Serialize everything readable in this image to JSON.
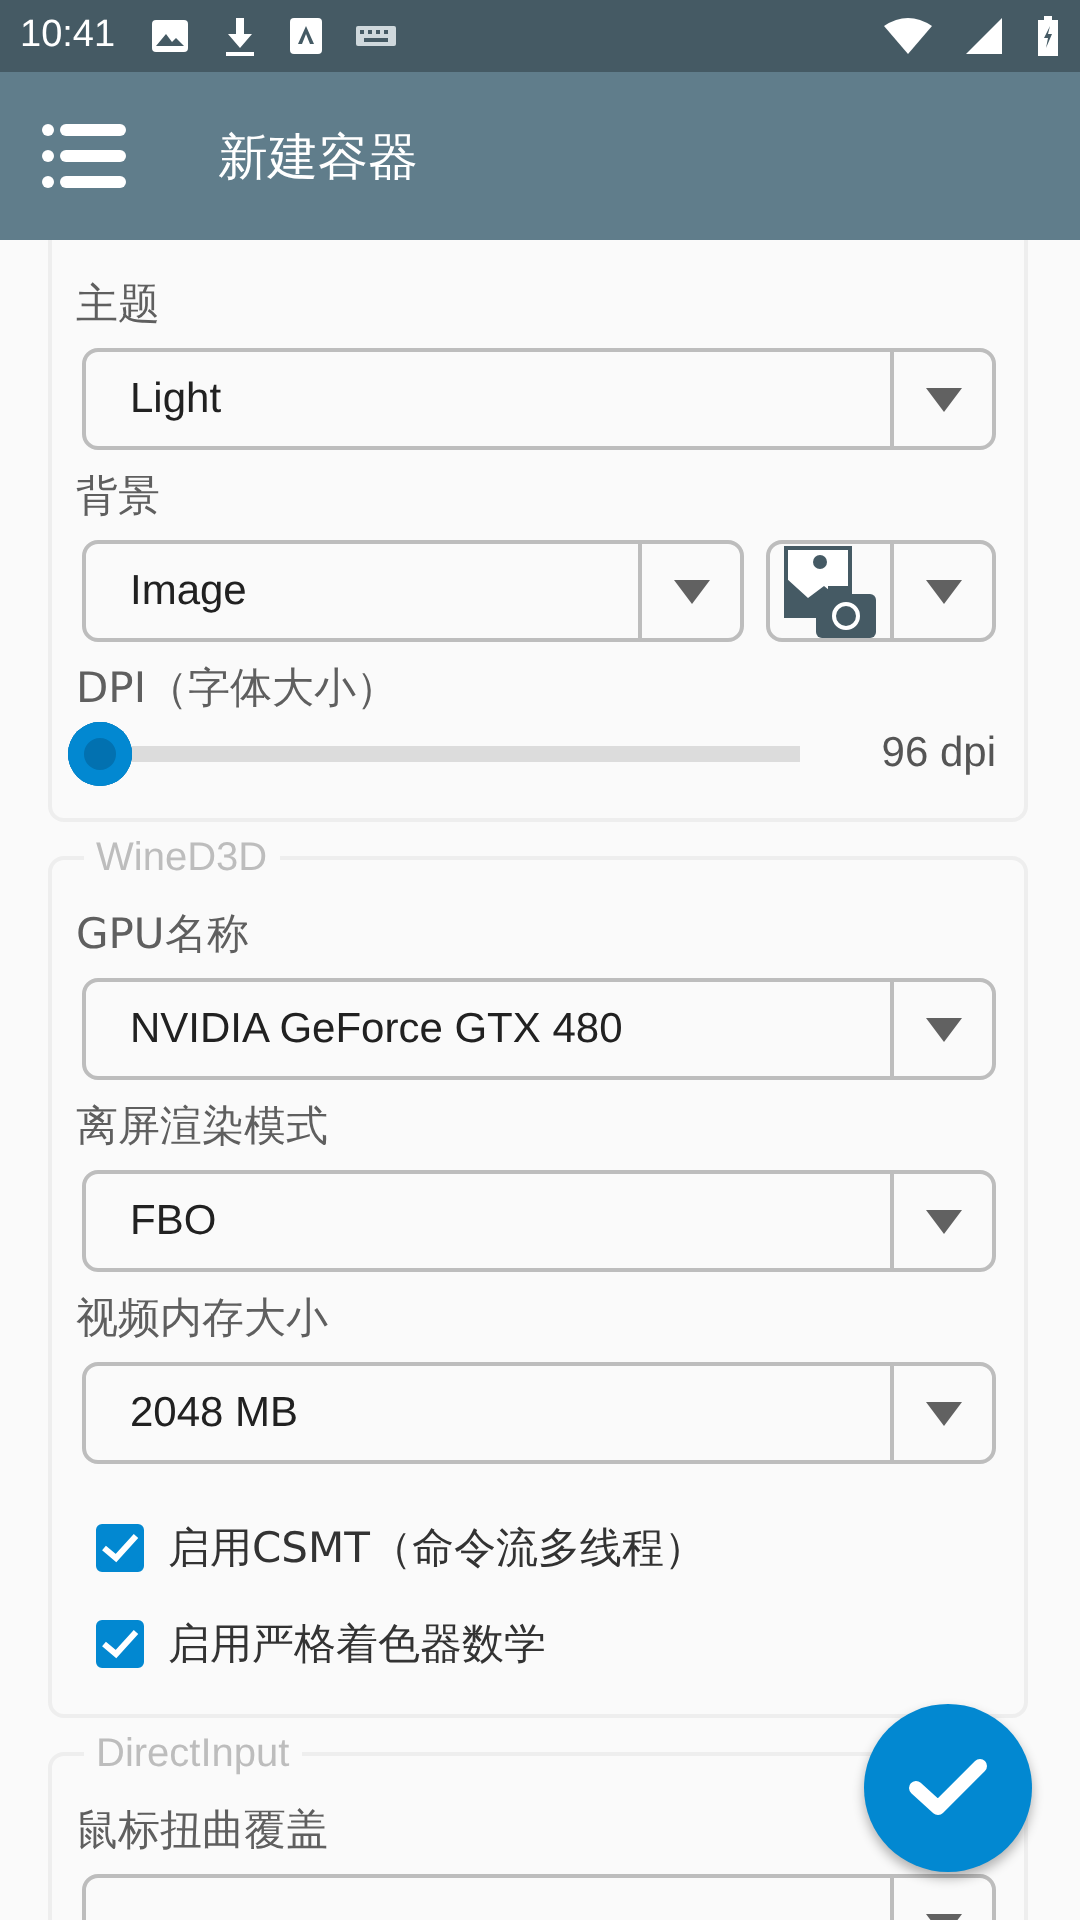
{
  "status_bar": {
    "time": "10:41"
  },
  "app_bar": {
    "title": "新建容器"
  },
  "sections": [
    {
      "items": [
        {
          "kind": "dropdown",
          "label": "主题",
          "value": "Light"
        },
        {
          "kind": "image_dropdown",
          "label": "背景",
          "value": "Image"
        },
        {
          "kind": "slider",
          "label": "DPI（字体大小）",
          "level": 0,
          "reading": "96 dpi"
        }
      ]
    },
    {
      "legend": "WineD3D",
      "items": [
        {
          "kind": "dropdown",
          "label": "GPU名称",
          "value": "NVIDIA GeForce GTX 480"
        },
        {
          "kind": "dropdown",
          "label": "离屏渲染模式",
          "value": "FBO"
        },
        {
          "kind": "dropdown",
          "label": "视频内存大小",
          "value": "2048 MB"
        },
        {
          "kind": "checkbox",
          "label": "启用CSMT（命令流多线程）",
          "checked": true
        },
        {
          "kind": "checkbox",
          "label": "启用严格着色器数学",
          "checked": true
        }
      ]
    },
    {
      "legend": "DirectInput",
      "items": [
        {
          "kind": "dropdown",
          "label": "鼠标扭曲覆盖"
        }
      ]
    }
  ]
}
